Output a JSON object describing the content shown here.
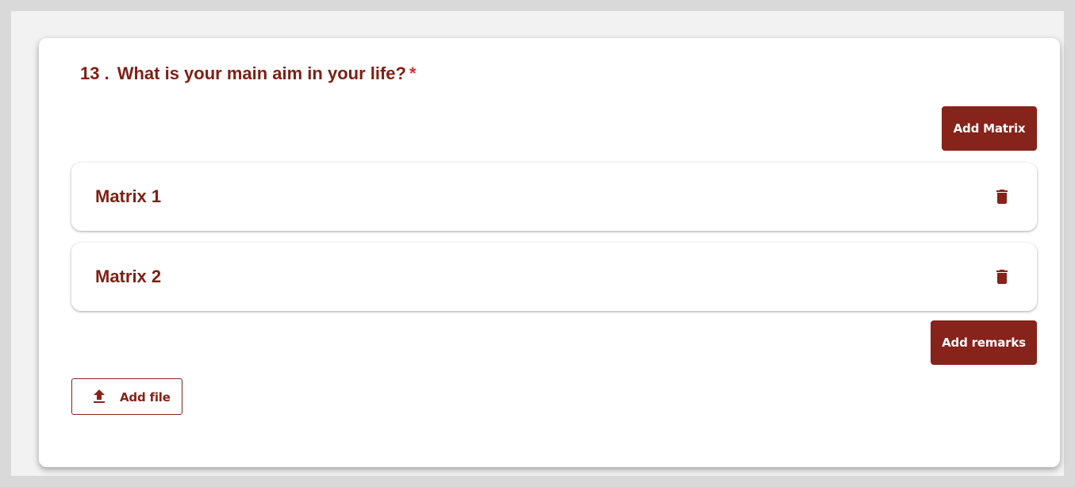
{
  "question": {
    "number": "13 .",
    "text": "What is your main aim in your life?",
    "required_mark": "*"
  },
  "buttons": {
    "add_matrix": "Add Matrix",
    "add_remarks": "Add remarks",
    "add_file": "Add file"
  },
  "matrices": [
    {
      "title": "Matrix 1",
      "icon": "trash-icon"
    },
    {
      "title": "Matrix 2",
      "icon": "trash-icon"
    }
  ],
  "icons": {
    "delete": "trash-icon",
    "upload": "upload-icon"
  },
  "colors": {
    "accent": "#86231a",
    "text": "#7f1f14",
    "required": "#d32f2f"
  }
}
